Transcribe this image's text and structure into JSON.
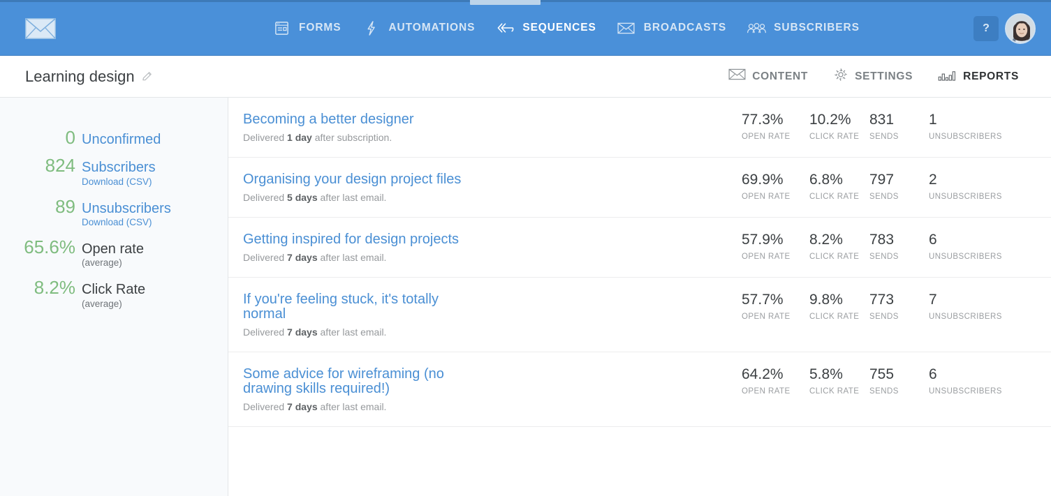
{
  "topnav": {
    "logo_icon": "envelope-logo-icon",
    "items": [
      {
        "label": "FORMS",
        "icon": "form-window-icon",
        "active": false
      },
      {
        "label": "AUTOMATIONS",
        "icon": "lightning-bolt-icon",
        "active": false
      },
      {
        "label": "SEQUENCES",
        "icon": "double-chevron-arrow-icon",
        "active": true
      },
      {
        "label": "BROADCASTS",
        "icon": "envelope-icon",
        "active": false
      },
      {
        "label": "SUBSCRIBERS",
        "icon": "people-group-icon",
        "active": false
      }
    ],
    "help_label": "?",
    "avatar_name": "user-avatar",
    "bg_color": "#4a90d9",
    "active_indicator_color": "#bcd4ea"
  },
  "subheader": {
    "title": "Learning design",
    "edit_icon": "pencil-icon",
    "tabs": [
      {
        "label": "CONTENT",
        "icon": "envelope-icon",
        "active": false
      },
      {
        "label": "SETTINGS",
        "icon": "gear-icon",
        "active": false
      },
      {
        "label": "REPORTS",
        "icon": "bar-chart-icon",
        "active": true
      }
    ]
  },
  "sidebar": {
    "stats": [
      {
        "value": "0",
        "label": "Unconfirmed",
        "sub": "",
        "label_link": true,
        "sub_link": false
      },
      {
        "value": "824",
        "label": "Subscribers",
        "sub": "Download (CSV)",
        "label_link": true,
        "sub_link": true
      },
      {
        "value": "89",
        "label": "Unsubscribers",
        "sub": "Download (CSV)",
        "label_link": true,
        "sub_link": true
      },
      {
        "value": "65.6%",
        "label": "Open rate",
        "sub": "(average)",
        "label_link": false,
        "sub_link": false
      },
      {
        "value": "8.2%",
        "label": "Click Rate",
        "sub": "(average)",
        "label_link": false,
        "sub_link": false
      }
    ],
    "value_color": "#7fbc7f",
    "link_color": "#4a8fd4"
  },
  "main": {
    "metric_names": {
      "open": "OPEN RATE",
      "click": "CLICK RATE",
      "sends": "SENDS",
      "unsub": "UNSUBSCRIBERS"
    },
    "emails": [
      {
        "title": "Becoming a better designer",
        "delivery_prefix": "Delivered ",
        "delivery_bold": "1 day",
        "delivery_suffix": " after subscription.",
        "open_rate": "77.3%",
        "click_rate": "10.2%",
        "sends": "831",
        "unsubscribers": "1"
      },
      {
        "title": "Organising your design project files",
        "delivery_prefix": "Delivered ",
        "delivery_bold": "5 days",
        "delivery_suffix": " after last email.",
        "open_rate": "69.9%",
        "click_rate": "6.8%",
        "sends": "797",
        "unsubscribers": "2"
      },
      {
        "title": "Getting inspired for design projects",
        "delivery_prefix": "Delivered ",
        "delivery_bold": "7 days",
        "delivery_suffix": " after last email.",
        "open_rate": "57.9%",
        "click_rate": "8.2%",
        "sends": "783",
        "unsubscribers": "6"
      },
      {
        "title": "If you're feeling stuck, it's totally normal",
        "delivery_prefix": "Delivered ",
        "delivery_bold": "7 days",
        "delivery_suffix": " after last email.",
        "open_rate": "57.7%",
        "click_rate": "9.8%",
        "sends": "773",
        "unsubscribers": "7"
      },
      {
        "title": "Some advice for wireframing (no drawing skills required!)",
        "delivery_prefix": "Delivered ",
        "delivery_bold": "7 days",
        "delivery_suffix": " after last email.",
        "open_rate": "64.2%",
        "click_rate": "5.8%",
        "sends": "755",
        "unsubscribers": "6"
      }
    ]
  }
}
